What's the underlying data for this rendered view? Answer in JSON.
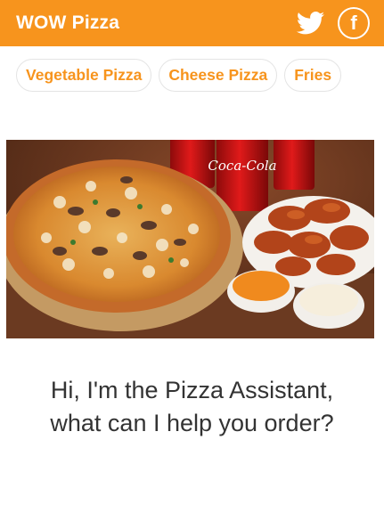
{
  "app": {
    "title": "WOW Pizza",
    "accent_color": "#f7941d",
    "actions": [
      {
        "icon": "twitter-icon"
      },
      {
        "icon": "facebook-icon",
        "glyph": "f"
      }
    ]
  },
  "suggestions": [
    {
      "label": "Vegetable Pizza"
    },
    {
      "label": "Cheese Pizza"
    },
    {
      "label": "Fries"
    }
  ],
  "hero_image": {
    "subject": "pizza-wings-cola-photo",
    "can_text": "Coca-Cola"
  },
  "assistant": {
    "line1": "Hi, I'm the Pizza Assistant,",
    "line2": "what can I help you order?"
  }
}
